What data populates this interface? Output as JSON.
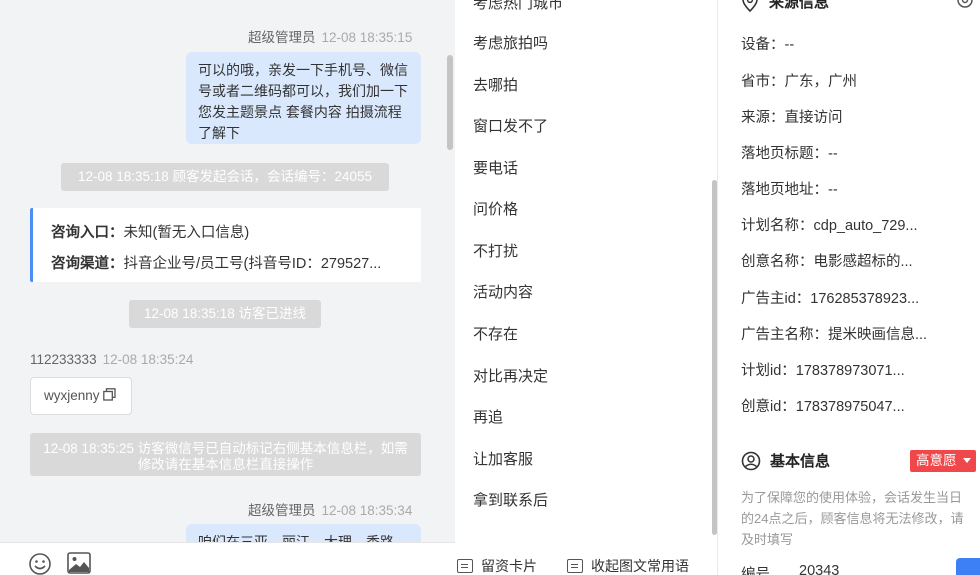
{
  "chat": {
    "msg1": {
      "sender": "超级管理员",
      "time": "12-08 18:35:15",
      "text": "可以的哦，亲发一下手机号、微信号或者二维码都可以，我们加一下您发主题景点 套餐内容 拍摄流程了解下"
    },
    "sys1": "12-08 18:35:18 顾客发起会话，会话编号：24055",
    "entry_card": {
      "entry_label": "咨询入口：",
      "entry_value": "未知(暂无入口信息)",
      "channel_label": "咨询渠道：",
      "channel_value": "抖音企业号/员工号(抖音号ID：279527..."
    },
    "sys2": "12-08 18:35:18 访客已进线",
    "msg2": {
      "sender": "112233333",
      "time": "12-08 18:35:24",
      "text": "wyxjenny"
    },
    "sys3": "12-08 18:35:25 访客微信号已自动标记右侧基本信息栏，如需修改请在基本信息栏直接操作",
    "msg3": {
      "sender": "超级管理员",
      "time": "12-08 18:35:34",
      "text": "咱们在三亚、丽江、大理、秀路"
    }
  },
  "quick_replies": {
    "items": [
      "考虑热门城市",
      "考虑旅拍吗",
      "去哪拍",
      "窗口发不了",
      "要电话",
      "问价格",
      "不打扰",
      "活动内容",
      "不存在",
      "对比再决定",
      "再追",
      "让加客服",
      "拿到联系后"
    ],
    "bottom_left": "留资卡片",
    "bottom_right": "收起图文常用语"
  },
  "info": {
    "source_title": "来源信息",
    "rows": [
      "设备：--",
      "省市：广东，广州",
      "来源：直接访问",
      "落地页标题：--",
      "落地页地址：--",
      "计划名称：cdp_auto_729...",
      "创意名称：电影感超标的...",
      "广告主id：176285378923...",
      "广告主名称：提米映画信息...",
      "计划id：178378973071...",
      "创意id：178378975047..."
    ],
    "basic_title": "基本信息",
    "intent_badge": "高意愿",
    "hint": "为了保障您的使用体验，会话发生当日的24点之后，顾客信息将无法修改，请及时填写",
    "id_label": "编号",
    "id_value": "20343"
  },
  "colors": {
    "accent": "#4a8ef6",
    "bubble": "#d9e8fd",
    "badge": "#f0484a"
  }
}
